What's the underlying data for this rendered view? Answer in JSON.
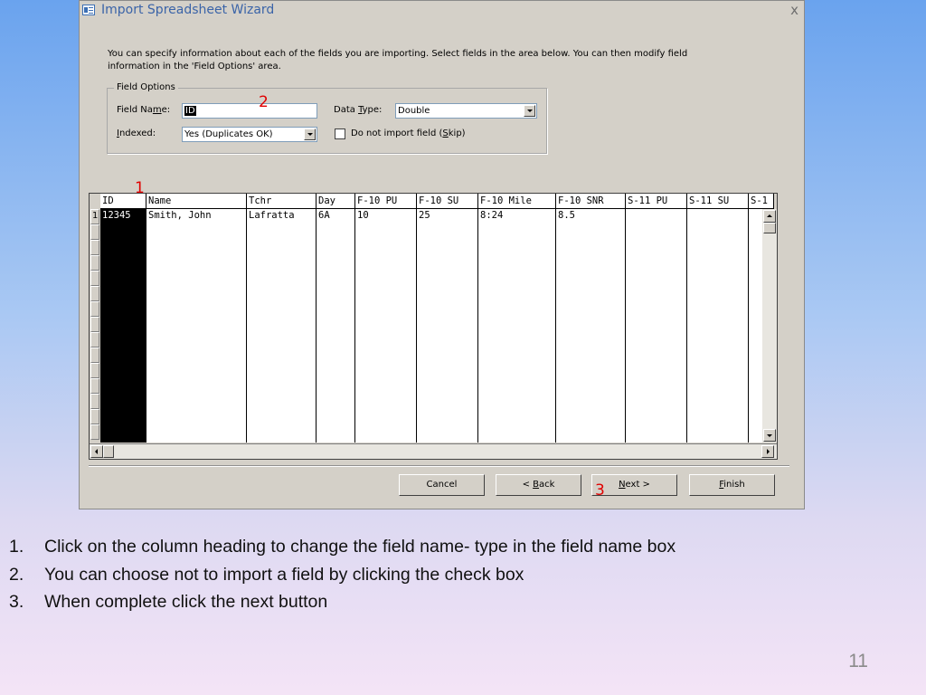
{
  "dialog": {
    "title": "Import Spreadsheet Wizard",
    "close_label": "x",
    "intro_text": "You can specify information about each of the fields you are importing.  Select fields in the area below. You can then modify field information in the 'Field Options' area.",
    "field_options": {
      "legend": "Field Options",
      "field_name_label": "Field Name:",
      "field_name_value": "ID",
      "data_type_label": "Data Type:",
      "data_type_value": "Double",
      "indexed_label": "Indexed:",
      "indexed_value": "Yes (Duplicates OK)",
      "skip_label": "Do not import field (Skip)",
      "skip_checked": false
    },
    "grid": {
      "columns": [
        "ID",
        "Name",
        "Tchr",
        "Day",
        "F-10 PU",
        "F-10 SU",
        "F-10 Mile",
        "F-10 SNR",
        "S-11 PU",
        "S-11 SU",
        "S-1"
      ],
      "row_number": "1",
      "row": [
        "12345",
        "Smith, John",
        "Lafratta",
        "6A",
        "10",
        "25",
        "8:24",
        "8.5",
        "",
        "",
        ""
      ]
    },
    "buttons": {
      "cancel": "Cancel",
      "back": "< Back",
      "next": "Next >",
      "finish": "Finish"
    }
  },
  "callouts": {
    "one": "1",
    "two": "2",
    "three": "3"
  },
  "steps": [
    {
      "num": "1.",
      "text": "Click on the column heading to change the field name- type in the field name box"
    },
    {
      "num": "2.",
      "text": "You can choose not to import a field by clicking the check box"
    },
    {
      "num": "3.",
      "text": "When complete click the next button"
    }
  ],
  "page_number": "11"
}
